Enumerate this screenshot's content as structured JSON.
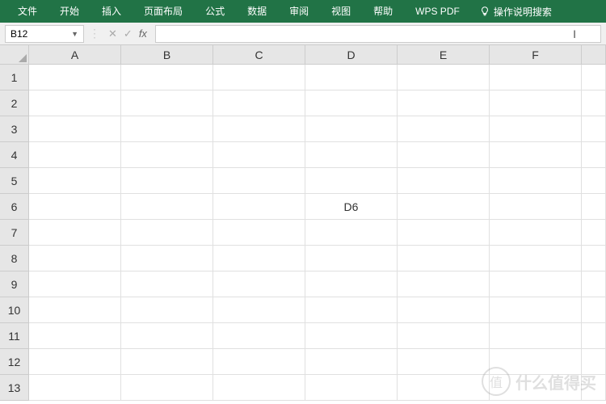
{
  "ribbon": {
    "tabs": [
      "文件",
      "开始",
      "插入",
      "页面布局",
      "公式",
      "数据",
      "审阅",
      "视图",
      "帮助",
      "WPS PDF"
    ],
    "help_search": "操作说明搜索"
  },
  "formula_bar": {
    "name_box_value": "B12",
    "cancel": "✕",
    "confirm": "✓",
    "fx": "fx",
    "formula_value": ""
  },
  "grid": {
    "columns": [
      "A",
      "B",
      "C",
      "D",
      "E",
      "F"
    ],
    "rows": [
      "1",
      "2",
      "3",
      "4",
      "5",
      "6",
      "7",
      "8",
      "9",
      "10",
      "11",
      "12",
      "13"
    ],
    "cells": {
      "D6": "D6"
    }
  },
  "watermark": {
    "badge": "值",
    "text": "什么值得买"
  }
}
